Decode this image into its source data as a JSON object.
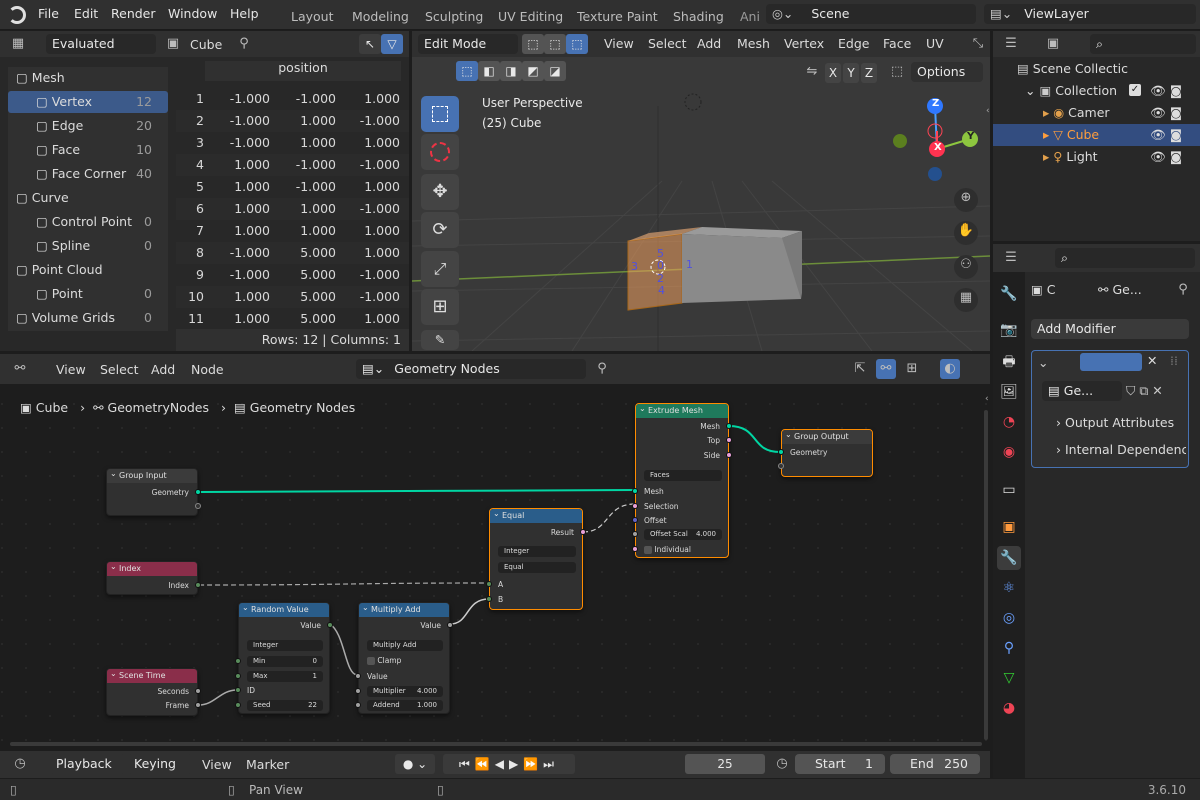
{
  "topbar": {
    "menus": [
      "File",
      "Edit",
      "Render",
      "Window",
      "Help"
    ],
    "workspaces": [
      "Layout",
      "Modeling",
      "Sculpting",
      "UV Editing",
      "Texture Paint",
      "Shading",
      "Ani"
    ],
    "scene": "Scene",
    "view_layer": "ViewLayer"
  },
  "spreadsheet": {
    "header_mode": "Evaluated",
    "object": "Cube",
    "column": "position",
    "tree": [
      {
        "label": "Mesh",
        "count": "",
        "indent": 0,
        "icon": "mesh-icon"
      },
      {
        "label": "Vertex",
        "count": "12",
        "indent": 1,
        "icon": "vertex-icon",
        "active": true
      },
      {
        "label": "Edge",
        "count": "20",
        "indent": 1,
        "icon": "edge-icon"
      },
      {
        "label": "Face",
        "count": "10",
        "indent": 1,
        "icon": "face-icon"
      },
      {
        "label": "Face Corner",
        "count": "40",
        "indent": 1,
        "icon": "face-corner-icon"
      },
      {
        "label": "Curve",
        "count": "",
        "indent": 0,
        "icon": "curve-icon"
      },
      {
        "label": "Control Point",
        "count": "0",
        "indent": 1,
        "icon": "control-point-icon"
      },
      {
        "label": "Spline",
        "count": "0",
        "indent": 1,
        "icon": "spline-icon"
      },
      {
        "label": "Point Cloud",
        "count": "",
        "indent": 0,
        "icon": "point-cloud-icon"
      },
      {
        "label": "Point",
        "count": "0",
        "indent": 1,
        "icon": "point-icon"
      },
      {
        "label": "Volume Grids",
        "count": "0",
        "indent": 0,
        "icon": "volume-icon"
      }
    ],
    "rows": [
      [
        "1",
        "-1.000",
        "-1.000",
        "1.000"
      ],
      [
        "2",
        "-1.000",
        "1.000",
        "-1.000"
      ],
      [
        "3",
        "-1.000",
        "1.000",
        "1.000"
      ],
      [
        "4",
        "1.000",
        "-1.000",
        "-1.000"
      ],
      [
        "5",
        "1.000",
        "-1.000",
        "1.000"
      ],
      [
        "6",
        "1.000",
        "1.000",
        "-1.000"
      ],
      [
        "7",
        "1.000",
        "1.000",
        "1.000"
      ],
      [
        "8",
        "-1.000",
        "5.000",
        "1.000"
      ],
      [
        "9",
        "-1.000",
        "5.000",
        "-1.000"
      ],
      [
        "10",
        "1.000",
        "5.000",
        "-1.000"
      ],
      [
        "11",
        "1.000",
        "5.000",
        "1.000"
      ]
    ],
    "footer": "Rows: 12   |   Columns: 1"
  },
  "viewport": {
    "mode": "Edit Mode",
    "menus": [
      "View",
      "Select",
      "Add",
      "Mesh",
      "Vertex",
      "Edge",
      "Face",
      "UV"
    ],
    "perspective": "User Perspective",
    "object_label": "(25) Cube",
    "axes": [
      "X",
      "Y",
      "Z"
    ],
    "options": "Options",
    "vertex_labels": [
      "5",
      "0",
      "3",
      "1",
      "2",
      "4"
    ],
    "gizmo": {
      "x": "X",
      "y": "Y",
      "z": "Z"
    }
  },
  "outliner": {
    "root": "Scene Collectic",
    "collection": "Collection",
    "items": [
      "Camer",
      "Cube",
      "Light"
    ]
  },
  "properties": {
    "breadcrumb_obj": "C",
    "breadcrumb_mod": "Ge...",
    "add_modifier": "Add Modifier",
    "nodegroup": "Ge...",
    "sections": [
      "Output Attributes",
      "Internal Dependencie"
    ]
  },
  "node_editor": {
    "menus": [
      "View",
      "Select",
      "Add",
      "Node"
    ],
    "tree_name": "Geometry Nodes",
    "breadcrumb": [
      "Cube",
      "GeometryNodes",
      "Geometry Nodes"
    ]
  },
  "nodes": {
    "group_input": {
      "title": "Group Input",
      "out": "Geometry"
    },
    "index": {
      "title": "Index",
      "out": "Index"
    },
    "scene_time": {
      "title": "Scene Time",
      "out1": "Seconds",
      "out2": "Frame"
    },
    "random": {
      "title": "Random Value",
      "out": "Value",
      "type": "Integer",
      "min_label": "Min",
      "min": "0",
      "max_label": "Max",
      "max": "1",
      "id": "ID",
      "seed_label": "Seed",
      "seed": "22"
    },
    "muladd": {
      "title": "Multiply Add",
      "out": "Value",
      "op": "Multiply Add",
      "clamp": "Clamp",
      "in": "Value",
      "mul_label": "Multiplier",
      "mul": "4.000",
      "add_label": "Addend",
      "add": "1.000"
    },
    "equal": {
      "title": "Equal",
      "out": "Result",
      "type": "Integer",
      "mode": "Equal",
      "a": "A",
      "b": "B"
    },
    "extrude": {
      "title": "Extrude Mesh",
      "out1": "Mesh",
      "out2": "Top",
      "out3": "Side",
      "mode": "Faces",
      "in1": "Mesh",
      "in2": "Selection",
      "in3": "Offset",
      "scale_label": "Offset Scal",
      "scale": "4.000",
      "indiv": "Individual"
    },
    "group_output": {
      "title": "Group Output",
      "in": "Geometry"
    }
  },
  "timeline": {
    "menus": [
      "Playback",
      "Keying",
      "View",
      "Marker"
    ],
    "frame": "25",
    "start_label": "Start",
    "start": "1",
    "end_label": "End",
    "end": "250"
  },
  "statusbar": {
    "hint": "Pan View",
    "version": "3.6.10"
  },
  "colors": {
    "accent": "#4772b3",
    "selected": "#ff8c00",
    "geometry_socket": "#00d6a3",
    "int_socket": "#598c5c",
    "float_socket": "#a1a1a1"
  }
}
